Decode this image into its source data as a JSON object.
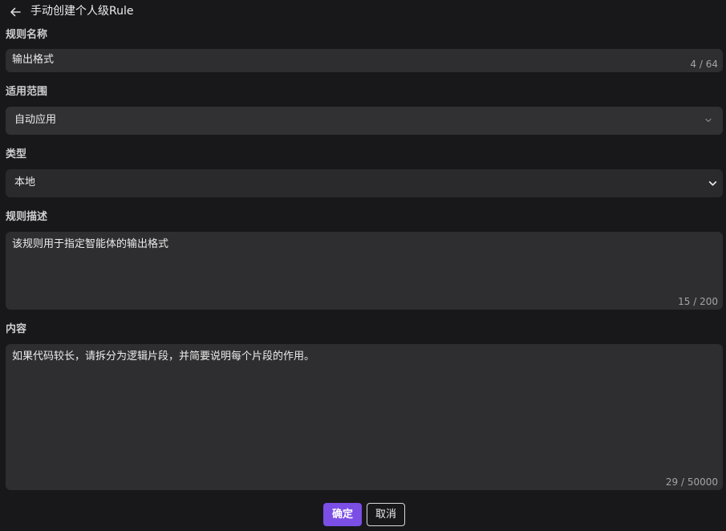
{
  "header": {
    "title": "手动创建个人级Rule",
    "back_icon": "arrow-left-icon"
  },
  "fields": {
    "rule_name": {
      "label": "规则名称",
      "value": "输出格式",
      "counter": "4 / 64"
    },
    "scope": {
      "label": "适用范围",
      "value": "自动应用"
    },
    "type": {
      "label": "类型",
      "value": "本地"
    },
    "description": {
      "label": "规则描述",
      "value": "该规则用于指定智能体的输出格式",
      "counter": "15 / 200"
    },
    "content": {
      "label": "内容",
      "value": "如果代码较长，请拆分为逻辑片段，并简要说明每个片段的作用。",
      "counter": "29 / 50000"
    }
  },
  "actions": {
    "confirm_label": "确定",
    "cancel_label": "取消"
  },
  "colors": {
    "background": "#18181b",
    "field_bg": "#2e2e30",
    "accent": "#7b4ee6"
  }
}
